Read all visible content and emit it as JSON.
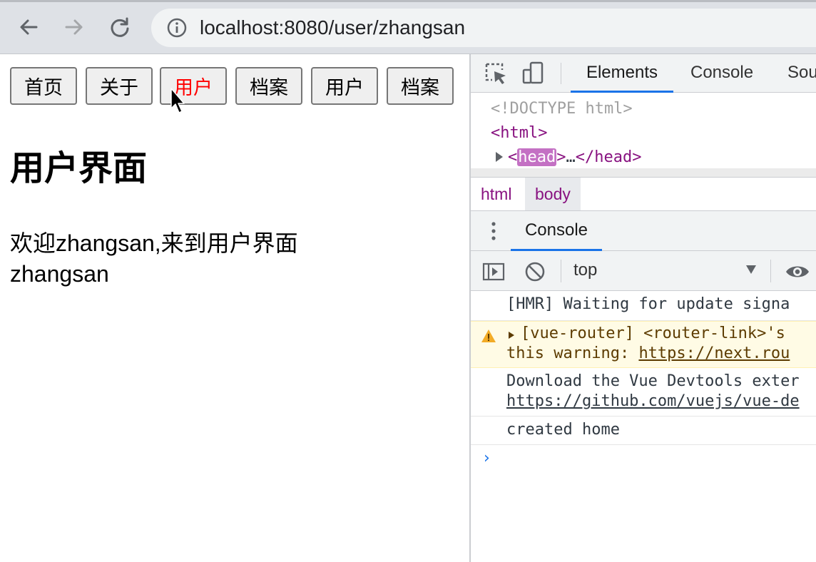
{
  "browser": {
    "url": "localhost:8080/user/zhangsan",
    "icons": [
      "back-arrow-icon",
      "forward-arrow-icon",
      "reload-icon",
      "info-icon"
    ]
  },
  "page": {
    "nav": [
      {
        "label": "首页",
        "active": false
      },
      {
        "label": "关于",
        "active": false
      },
      {
        "label": "用户",
        "active": true
      },
      {
        "label": "档案",
        "active": false
      },
      {
        "label": "用户",
        "active": false
      },
      {
        "label": "档案",
        "active": false
      }
    ],
    "title": "用户界面",
    "welcome": "欢迎zhangsan,来到用户界面",
    "username": "zhangsan",
    "active_color": "#ff0000"
  },
  "devtools": {
    "tabs": [
      "Elements",
      "Console",
      "Sou"
    ],
    "active_tab": "Elements",
    "elements": {
      "doctype": "<!DOCTYPE html>",
      "html_open": "html",
      "head_tag": "head",
      "head_ellipsis": "…",
      "head_close": "</head>"
    },
    "breadcrumbs": [
      "html",
      "body"
    ],
    "drawer_tab": "Console",
    "context": "top",
    "console": {
      "hmr": "[HMR] Waiting for update signa",
      "warn_line1": "[vue-router] <router-link>'s",
      "warn_line2_prefix": "this warning: ",
      "warn_link": "https://next.rou",
      "download_line1": "Download the Vue Devtools exter",
      "download_link": "https://github.com/vuejs/vue-de",
      "created": "created home",
      "prompt": "›"
    },
    "accent_color": "#1a73e8"
  }
}
